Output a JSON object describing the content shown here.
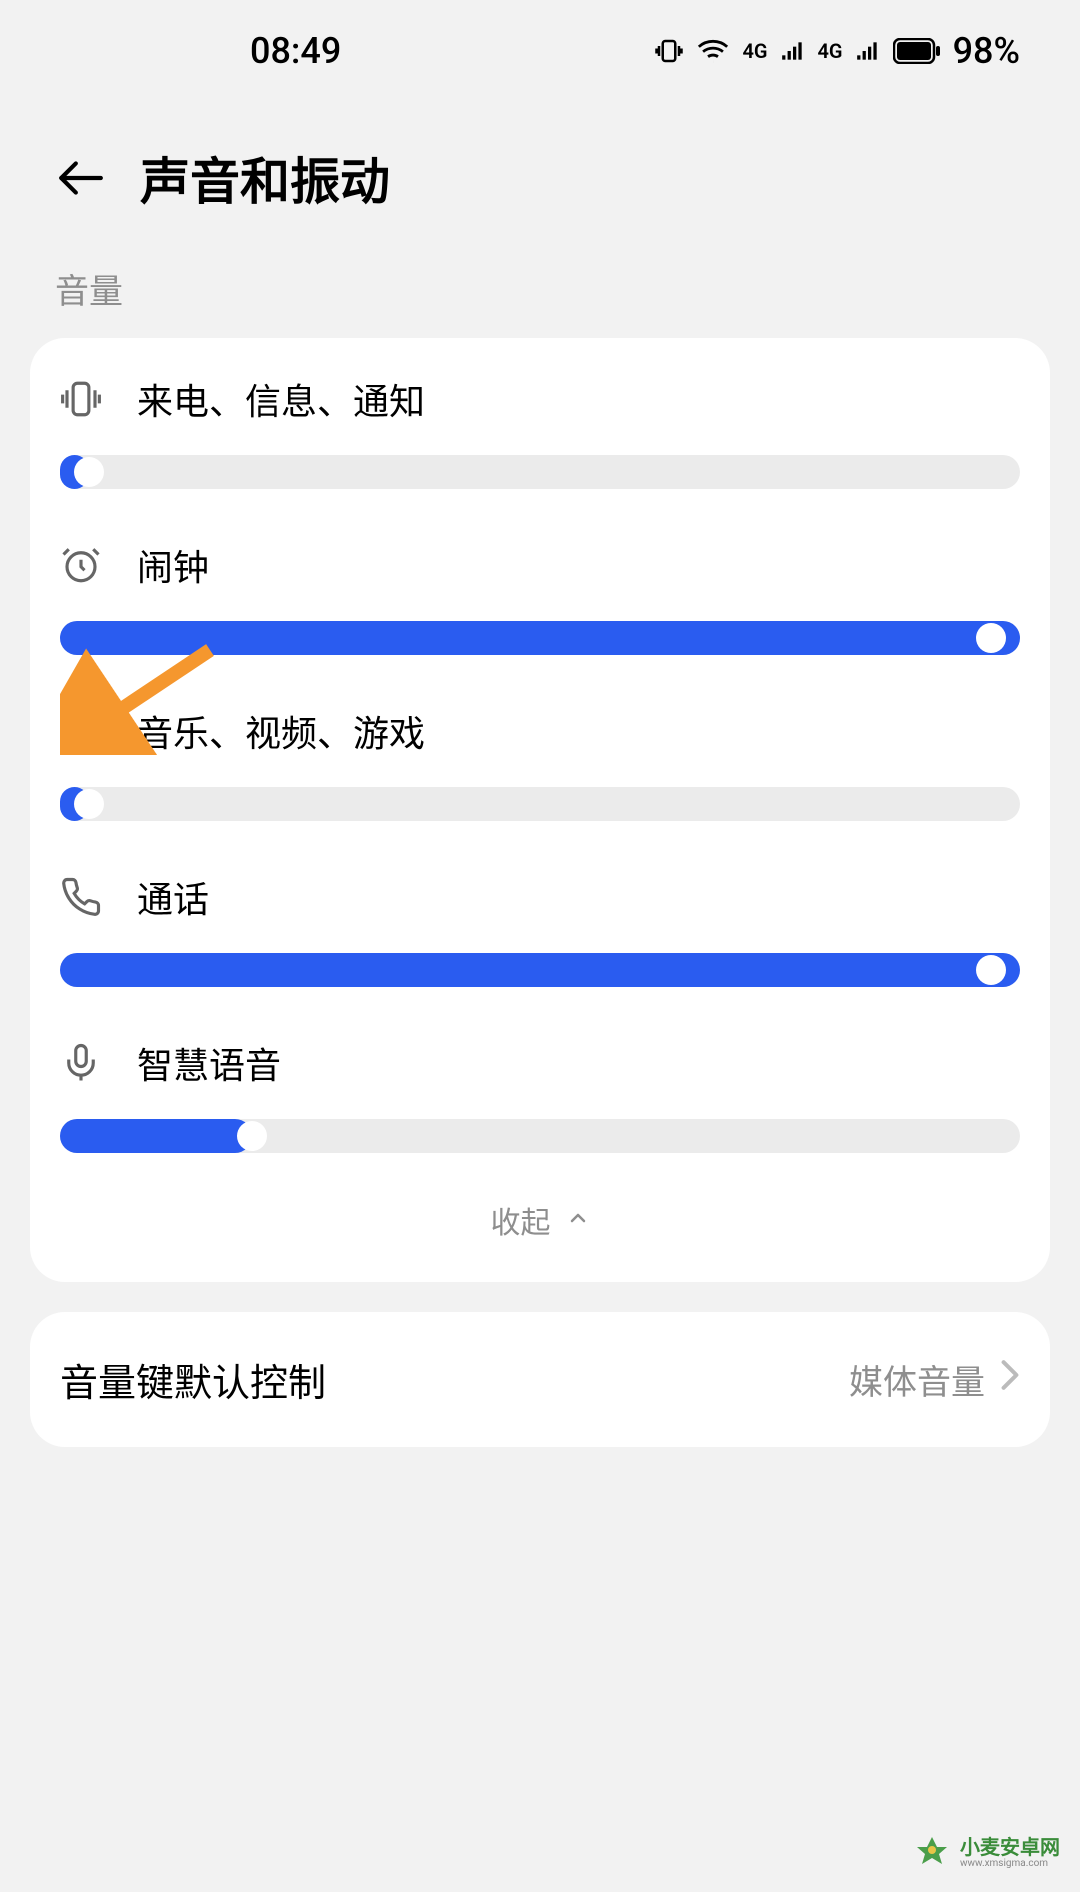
{
  "status_bar": {
    "time": "08:49",
    "battery_percent": "98%",
    "signal_text_1": "4G",
    "signal_text_2": "4G"
  },
  "header": {
    "title": "声音和振动"
  },
  "section_label": "音量",
  "volume_items": [
    {
      "label": "来电、信息、通知",
      "value": 2,
      "icon": "vibrate"
    },
    {
      "label": "闹钟",
      "value": 98,
      "icon": "alarm"
    },
    {
      "label": "音乐、视频、游戏",
      "value": 2,
      "icon": "mute"
    },
    {
      "label": "通话",
      "value": 98,
      "icon": "phone"
    },
    {
      "label": "智慧语音",
      "value": 20,
      "icon": "mic"
    }
  ],
  "collapse_label": "收起",
  "list_item": {
    "label": "音量键默认控制",
    "value": "媒体音量"
  },
  "watermark": {
    "main": "小麦安卓网",
    "sub": "www.xmsigma.com"
  }
}
